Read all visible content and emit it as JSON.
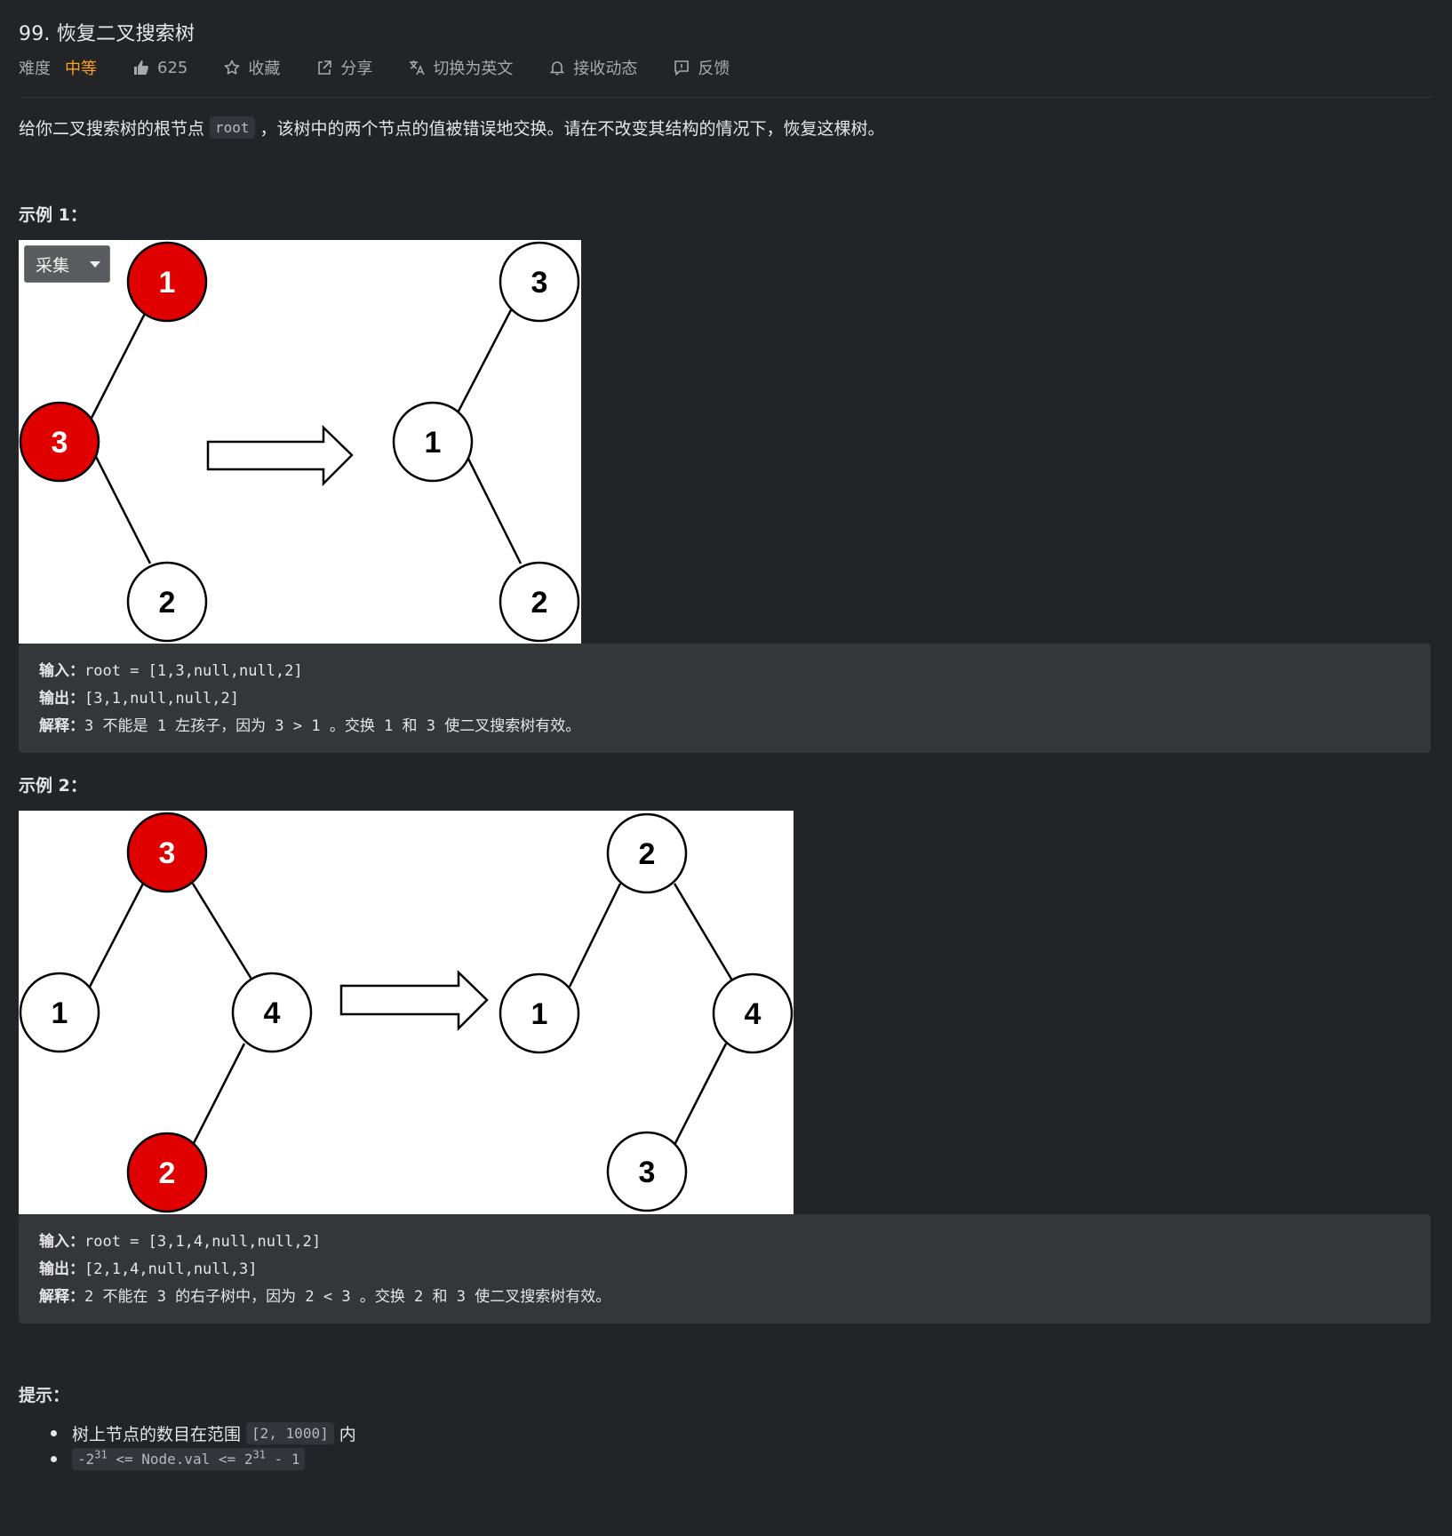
{
  "header": {
    "title": "99. 恢复二叉搜索树",
    "difficulty_label": "难度",
    "difficulty": "中等",
    "likes": "625",
    "favorite_label": "收藏",
    "share_label": "分享",
    "switch_lang_label": "切换为英文",
    "subscribe_label": "接收动态",
    "feedback_label": "反馈"
  },
  "description": {
    "before": "给你二叉搜索树的根节点",
    "code": "root",
    "after": "，该树中的两个节点的值被错误地交换。请在不改变其结构的情况下，恢复这棵树。"
  },
  "capture_button": {
    "label": "采集"
  },
  "example1": {
    "heading": "示例 1：",
    "before_tree": {
      "nodes": [
        {
          "value": "1",
          "highlight": true
        },
        {
          "value": "3",
          "highlight": true
        },
        {
          "value": "2",
          "highlight": false
        }
      ]
    },
    "after_tree": {
      "nodes": [
        {
          "value": "3"
        },
        {
          "value": "1"
        },
        {
          "value": "2"
        }
      ]
    },
    "input_label": "输入：",
    "input": "root = [1,3,null,null,2]",
    "output_label": "输出：",
    "output": "[3,1,null,null,2]",
    "explain_label": "解释：",
    "explain": "3 不能是 1 左孩子，因为 3 > 1 。交换 1 和 3 使二叉搜索树有效。"
  },
  "example2": {
    "heading": "示例 2：",
    "before_tree": {
      "nodes": [
        {
          "value": "3",
          "highlight": true
        },
        {
          "value": "1",
          "highlight": false
        },
        {
          "value": "4",
          "highlight": false
        },
        {
          "value": "2",
          "highlight": true
        }
      ]
    },
    "after_tree": {
      "nodes": [
        {
          "value": "2"
        },
        {
          "value": "1"
        },
        {
          "value": "4"
        },
        {
          "value": "3"
        }
      ]
    },
    "input_label": "输入：",
    "input": "root = [3,1,4,null,null,2]",
    "output_label": "输出：",
    "output": "[2,1,4,null,null,3]",
    "explain_label": "解释：",
    "explain": "2 不能在 3 的右子树中，因为 2 < 3 。交换 2 和 3 使二叉搜索树有效。"
  },
  "hints": {
    "heading": "提示：",
    "item1_before": "树上节点的数目在范围",
    "item1_code": "[2, 1000]",
    "item1_after": "内",
    "item2_neg_base": "-2",
    "item2_exp1": "31",
    "item2_mid": " <= Node.val <= 2",
    "item2_exp2": "31",
    "item2_tail": " - 1"
  },
  "colors": {
    "background": "#232427",
    "accent_difficulty": "#ffa116",
    "node_highlight": "#e00000"
  }
}
